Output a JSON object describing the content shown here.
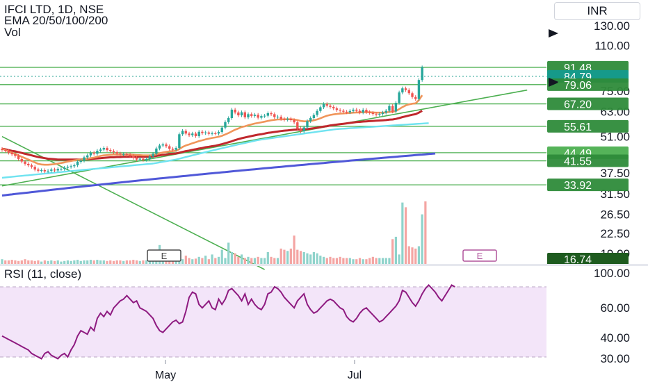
{
  "header": {
    "title": "IFCI LTD, 1D, NSE",
    "indicators": "EMA 20/50/100/200",
    "volume": "Vol",
    "currency": "INR"
  },
  "rsi": {
    "label": "RSI (11, close)"
  },
  "colors": {
    "up": "#26a69a",
    "down": "#ef5350",
    "ema20": "#f0955a",
    "ema50": "#c0282d",
    "ema100": "#6fe3f0",
    "ema200": "#5058d8",
    "trendline": "#4caf50",
    "level_badge": "#2e8b3a",
    "current_price": "#169a8a",
    "rsi_line": "#8e1a80",
    "rsi_band": "#f3e5f9"
  },
  "chart_data": [
    {
      "type": "candlestick",
      "title": "IFCI LTD, 1D, NSE",
      "scale": "log",
      "y_ticks": [
        130.0,
        110.0,
        75.0,
        63.0,
        51.0,
        37.5,
        31.5,
        26.5,
        22.5,
        19.0
      ],
      "x_ticks": [
        "May",
        "Jul"
      ],
      "horizontal_levels": [
        91.48,
        79.06,
        67.2,
        55.61,
        44.49,
        41.55,
        33.92
      ],
      "current_price": 84.79,
      "price_labels": [
        "91.48",
        "84.79",
        "79.06",
        "67.20",
        "55.61",
        "44.49",
        "41.55",
        "33.92",
        "16.74"
      ],
      "event_markers": [
        "E",
        "E"
      ],
      "candles_close": [
        45.5,
        45.2,
        44.5,
        43.9,
        43.3,
        42.2,
        41.3,
        40.5,
        40.0,
        39.5,
        38.6,
        38.2,
        38.4,
        38.0,
        38.2,
        38.6,
        38.3,
        38.8,
        38.8,
        39.2,
        39.5,
        39.7,
        40.0,
        41.2,
        41.6,
        42.8,
        43.5,
        44.5,
        44.1,
        45.2,
        45.7,
        46.3,
        45.5,
        45.1,
        44.7,
        44.2,
        43.9,
        44.0,
        43.7,
        43.3,
        42.6,
        42.0,
        42.3,
        41.9,
        42.2,
        43.1,
        44.1,
        46.1,
        47.3,
        47.7,
        47.0,
        46.0,
        45.6,
        46.3,
        52.0,
        53.5,
        52.3,
        51.6,
        52.3,
        51.2,
        53.1,
        52.5,
        52.8,
        52.2,
        52.4,
        52.3,
        53.0,
        55.0,
        57.6,
        59.6,
        64.0,
        62.5,
        61.0,
        62.6,
        60.0,
        61.6,
        60.7,
        61.3,
        59.8,
        60.6,
        60.8,
        62.1,
        61.6,
        60.1,
        60.3,
        59.2,
        58.8,
        59.3,
        58.6,
        57.5,
        54.6,
        53.3,
        55.1,
        58.1,
        59.6,
        61.2,
        63.3,
        65.3,
        67.1,
        66.2,
        65.5,
        64.7,
        63.8,
        63.4,
        62.9,
        62.6,
        63.3,
        64.0,
        63.4,
        62.5,
        63.9,
        62.7,
        62.3,
        61.7,
        61.3,
        61.7,
        62.4,
        63.4,
        66.0,
        63.0,
        67.8,
        74.0,
        76.6,
        75.5,
        73.5,
        71.2,
        70.0,
        82.2,
        91.48
      ],
      "candle_dir": "derived from consecutive closes",
      "volume_relative": [
        0.4,
        0.3,
        0.3,
        0.35,
        0.3,
        0.25,
        0.3,
        0.4,
        0.3,
        0.3,
        0.25,
        0.3,
        0.2,
        0.3,
        0.25,
        0.3,
        0.25,
        0.3,
        0.2,
        0.25,
        0.3,
        0.25,
        0.3,
        0.35,
        0.25,
        0.3,
        0.3,
        0.35,
        0.3,
        0.35,
        0.3,
        0.3,
        0.25,
        0.3,
        0.25,
        0.3,
        0.3,
        0.25,
        0.3,
        0.3,
        0.35,
        0.3,
        0.25,
        0.3,
        0.3,
        0.3,
        0.35,
        1.2,
        1.6,
        1.1,
        0.5,
        0.4,
        0.5,
        0.45,
        0.6,
        0.4,
        0.7,
        0.5,
        0.4,
        0.45,
        0.6,
        0.5,
        0.7,
        0.4,
        0.8,
        0.5,
        0.6,
        1.2,
        0.5,
        1.8,
        1.0,
        0.9,
        0.6,
        0.8,
        0.5,
        0.6,
        0.5,
        0.5,
        0.6,
        0.5,
        0.5,
        1.0,
        0.6,
        0.5,
        0.5,
        1.3,
        1.2,
        1.1,
        1.3,
        2.4,
        1.2,
        1.1,
        1.0,
        0.9,
        0.8,
        1.0,
        0.9,
        0.7,
        0.6,
        0.5,
        0.6,
        0.5,
        0.5,
        0.6,
        0.5,
        0.5,
        0.5,
        0.4,
        0.4,
        0.5,
        0.4,
        0.4,
        0.5,
        0.6,
        0.5,
        0.5,
        0.5,
        0.5,
        0.5,
        2.1,
        2.3,
        0.8,
        5.2,
        4.8,
        1.5,
        1.4,
        1.3,
        1.5,
        4.2,
        5.3
      ],
      "ema20": [
        46.0,
        45.5,
        45.0,
        44.5,
        44.0,
        43.5,
        43.0,
        42.5,
        42.0,
        41.5,
        41.0,
        40.5,
        40.3,
        40.2,
        40.2,
        40.3,
        40.4,
        40.6,
        40.8,
        41.0,
        41.3,
        41.5,
        41.7,
        41.9,
        42.0,
        42.1,
        42.3,
        42.5,
        42.7,
        43.0,
        43.3,
        43.5,
        43.6,
        43.7,
        43.8,
        43.8,
        43.8,
        43.8,
        43.8,
        43.8,
        43.7,
        43.6,
        43.6,
        43.5,
        43.5,
        43.5,
        43.6,
        43.9,
        44.3,
        44.6,
        44.8,
        45.0,
        45.1,
        45.2,
        45.9,
        46.7,
        47.3,
        47.7,
        48.2,
        48.6,
        49.1,
        49.4,
        49.8,
        50.1,
        50.4,
        50.6,
        50.9,
        51.3,
        51.9,
        52.5,
        53.3,
        54.0,
        54.6,
        55.3,
        55.6,
        56.1,
        56.5,
        56.9,
        57.2,
        57.5,
        57.8,
        58.2,
        58.5,
        58.7,
        58.9,
        58.9,
        59.0,
        59.0,
        59.0,
        58.9,
        58.6,
        58.2,
        58.0,
        58.0,
        58.2,
        58.5,
        58.9,
        59.5,
        60.2,
        60.8,
        61.2,
        61.5,
        61.7,
        61.9,
        62.0,
        62.1,
        62.2,
        62.4,
        62.5,
        62.5,
        62.6,
        62.6,
        62.6,
        62.5,
        62.4,
        62.4,
        62.4,
        62.5,
        62.8,
        62.8,
        63.3,
        64.3,
        65.4,
        66.3,
        66.9,
        67.3,
        67.5,
        69.3,
        72.3
      ],
      "ema50": [
        46.0,
        45.8,
        45.5,
        45.2,
        45.0,
        44.7,
        44.4,
        44.1,
        43.8,
        43.5,
        43.2,
        42.9,
        42.7,
        42.5,
        42.3,
        42.2,
        42.1,
        42.0,
        42.0,
        42.0,
        42.0,
        42.0,
        42.0,
        42.0,
        42.0,
        42.1,
        42.1,
        42.2,
        42.3,
        42.4,
        42.5,
        42.6,
        42.7,
        42.8,
        42.8,
        42.9,
        42.9,
        43.0,
        43.0,
        43.0,
        43.0,
        43.0,
        43.0,
        43.0,
        43.0,
        43.0,
        43.1,
        43.3,
        43.5,
        43.7,
        43.8,
        44.0,
        44.1,
        44.2,
        44.5,
        44.8,
        45.1,
        45.3,
        45.6,
        45.8,
        46.1,
        46.3,
        46.6,
        46.8,
        47.0,
        47.2,
        47.5,
        47.8,
        48.2,
        48.6,
        49.0,
        49.5,
        49.9,
        50.3,
        50.6,
        50.9,
        51.2,
        51.5,
        51.8,
        52.0,
        52.3,
        52.6,
        52.8,
        53.0,
        53.2,
        53.4,
        53.6,
        53.7,
        53.9,
        54.0,
        54.1,
        54.1,
        54.2,
        54.3,
        54.5,
        54.7,
        54.9,
        55.2,
        55.5,
        55.7,
        56.0,
        56.2,
        56.4,
        56.6,
        56.8,
        57.0,
        57.2,
        57.4,
        57.6,
        57.7,
        57.9,
        58.0,
        58.1,
        58.2,
        58.3,
        58.4,
        58.5,
        58.6,
        58.8,
        58.9,
        59.2,
        59.6,
        60.1,
        60.5,
        60.9,
        61.3,
        61.6,
        62.4,
        63.4
      ],
      "ema100": [
        36.0,
        36.1,
        36.2,
        36.3,
        36.4,
        36.5,
        36.6,
        36.7,
        36.8,
        36.9,
        37.0,
        37.1,
        37.2,
        37.3,
        37.4,
        37.5,
        37.6,
        37.7,
        37.8,
        37.9,
        38.0,
        38.1,
        38.2,
        38.3,
        38.4,
        38.5,
        38.6,
        38.7,
        38.8,
        38.9,
        39.0,
        39.1,
        39.2,
        39.3,
        39.4,
        39.5,
        39.6,
        39.7,
        39.8,
        39.9,
        40.0,
        40.1,
        40.2,
        40.3,
        40.4,
        40.5,
        40.6,
        40.8,
        41.0,
        41.2,
        41.4,
        41.6,
        41.8,
        42.0,
        42.3,
        42.6,
        42.9,
        43.2,
        43.5,
        43.8,
        44.1,
        44.4,
        44.7,
        45.0,
        45.3,
        45.6,
        45.9,
        46.2,
        46.5,
        46.8,
        47.1,
        47.4,
        47.7,
        48.0,
        48.3,
        48.6,
        48.9,
        49.2,
        49.5,
        49.7,
        49.9,
        50.1,
        50.3,
        50.5,
        50.7,
        50.9,
        51.1,
        51.3,
        51.5,
        51.7,
        51.9,
        52.1,
        52.3,
        52.5,
        52.7,
        52.9,
        53.1,
        53.3,
        53.5,
        53.7,
        53.9,
        54.1,
        54.3,
        54.4,
        54.5,
        54.6,
        54.7,
        54.8,
        54.9,
        55.0,
        55.1,
        55.2,
        55.3,
        55.4,
        55.5,
        55.6,
        55.7,
        55.8,
        55.9,
        56.0,
        56.1,
        56.2,
        56.3,
        56.4,
        56.5,
        56.6,
        56.7,
        56.8,
        56.9,
        57.0,
        57.1
      ],
      "ema200": [
        31.0,
        31.1,
        31.2,
        31.3,
        31.4,
        31.5,
        31.6,
        31.7,
        31.8,
        31.9,
        32.0,
        32.1,
        32.2,
        32.3,
        32.4,
        32.5,
        32.6,
        32.7,
        32.8,
        32.9,
        33.0,
        33.1,
        33.2,
        33.3,
        33.4,
        33.5,
        33.6,
        33.7,
        33.8,
        33.9,
        34.0,
        34.1,
        34.2,
        34.3,
        34.4,
        34.5,
        34.6,
        34.7,
        34.8,
        34.9,
        35.0,
        35.1,
        35.2,
        35.3,
        35.4,
        35.5,
        35.6,
        35.7,
        35.8,
        35.9,
        36.0,
        36.1,
        36.2,
        36.3,
        36.4,
        36.5,
        36.6,
        36.7,
        36.8,
        36.9,
        37.0,
        37.1,
        37.2,
        37.3,
        37.4,
        37.5,
        37.6,
        37.7,
        37.8,
        37.9,
        38.0,
        38.1,
        38.2,
        38.3,
        38.4,
        38.5,
        38.6,
        38.7,
        38.8,
        38.9,
        39.0,
        39.1,
        39.2,
        39.3,
        39.4,
        39.5,
        39.6,
        39.7,
        39.8,
        39.9,
        40.0,
        40.1,
        40.2,
        40.3,
        40.4,
        40.5,
        40.6,
        40.7,
        40.8,
        40.9,
        41.0,
        41.1,
        41.2,
        41.3,
        41.4,
        41.5,
        41.6,
        41.7,
        41.8,
        41.9,
        42.0,
        42.1,
        42.2,
        42.3,
        42.4,
        42.5,
        42.6,
        42.7,
        42.8,
        42.9,
        43.0,
        43.1,
        43.2,
        43.3,
        43.4,
        43.5,
        43.6,
        43.7,
        43.8,
        43.9,
        44.0,
        44.1,
        44.2
      ],
      "trendlines": [
        {
          "name": "rising support",
          "from": {
            "candle": 0,
            "price": 33.6
          },
          "to": {
            "candle": 160,
            "price": 75.5
          }
        },
        {
          "name": "falling line",
          "from": {
            "candle": 0,
            "price": 51.0
          },
          "to": {
            "candle": 80,
            "price": 16.6
          }
        }
      ]
    },
    {
      "type": "line",
      "title": "RSI (11, close)",
      "y_ticks": [
        100.0,
        60.0,
        40.0,
        30.0
      ],
      "band": [
        30,
        70
      ],
      "values": [
        42,
        41,
        40,
        39,
        38,
        37,
        36,
        35,
        34,
        32,
        31,
        30,
        29,
        32,
        33,
        31,
        30,
        29,
        31,
        32,
        30,
        34,
        37,
        42,
        45,
        44,
        43,
        47,
        45,
        52,
        55,
        53,
        56,
        54,
        58,
        60,
        62,
        63,
        65,
        63,
        61,
        62,
        58,
        57,
        56,
        54,
        52,
        48,
        45,
        44,
        46,
        48,
        50,
        51,
        49,
        50,
        56,
        64,
        67,
        66,
        60,
        58,
        60,
        62,
        58,
        57,
        63,
        60,
        63,
        68,
        69,
        67,
        65,
        62,
        66,
        60,
        63,
        60,
        58,
        57,
        60,
        66,
        67,
        70,
        69,
        67,
        64,
        62,
        60,
        58,
        62,
        64,
        66,
        60,
        57,
        55,
        56,
        58,
        60,
        62,
        63,
        62,
        60,
        58,
        57,
        53,
        51,
        50,
        52,
        55,
        57,
        58,
        56,
        54,
        52,
        50,
        51,
        53,
        55,
        57,
        59,
        62,
        68,
        67,
        64,
        61,
        59,
        62,
        66,
        69,
        71,
        69,
        67,
        64,
        62,
        65,
        68,
        71,
        70
      ]
    }
  ]
}
